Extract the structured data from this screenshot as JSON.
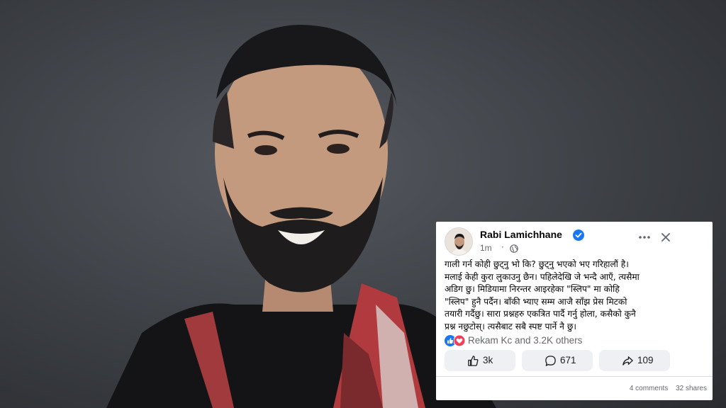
{
  "post": {
    "author": "Rabi Lamichhane",
    "time": "1m",
    "time_separator": "·",
    "body": "गाली गर्न कोही छुट्नु भो कि? छुट्नु भएको भए गरिहालौं है।\nमलाई केही कुरा लुकाउनु छैन। पहिलेदेखि जे भन्दै आएँ, त्यसैमा\nअडिग छु। मिडियामा निरन्तर आइरहेका \"स्लिप\" मा कोहि\n\"स्लिप\" हुनै पर्दैन।  बाँकी भ्याए सम्म आजै साँझ प्रेस मिटको\nतयारी गर्दैछु। सारा प्रश्नहरु एकत्रित पार्दै गर्नु होला, कसैको कुनै\nप्रश्न नछुटोस्। त्यसैबाट सबै स्पष्ट पार्ने नै छु।",
    "reactions_text": "Rekam Kc and 3.2K others",
    "like_count": "3k",
    "comment_count": "671",
    "share_count": "109",
    "comments_summary": "4 comments",
    "shares_summary": "32 shares"
  },
  "icons": {
    "verified": "verified-badge-icon",
    "globe": "globe-icon",
    "more": "more-options-icon",
    "close": "close-icon",
    "like": "thumbs-up-icon",
    "comment": "comment-bubble-icon",
    "share": "share-arrow-icon"
  },
  "colors": {
    "facebook_blue": "#1877f2",
    "love_red": "#f33e58",
    "button_bg": "#eef0f3",
    "secondary_text": "#65676b"
  }
}
